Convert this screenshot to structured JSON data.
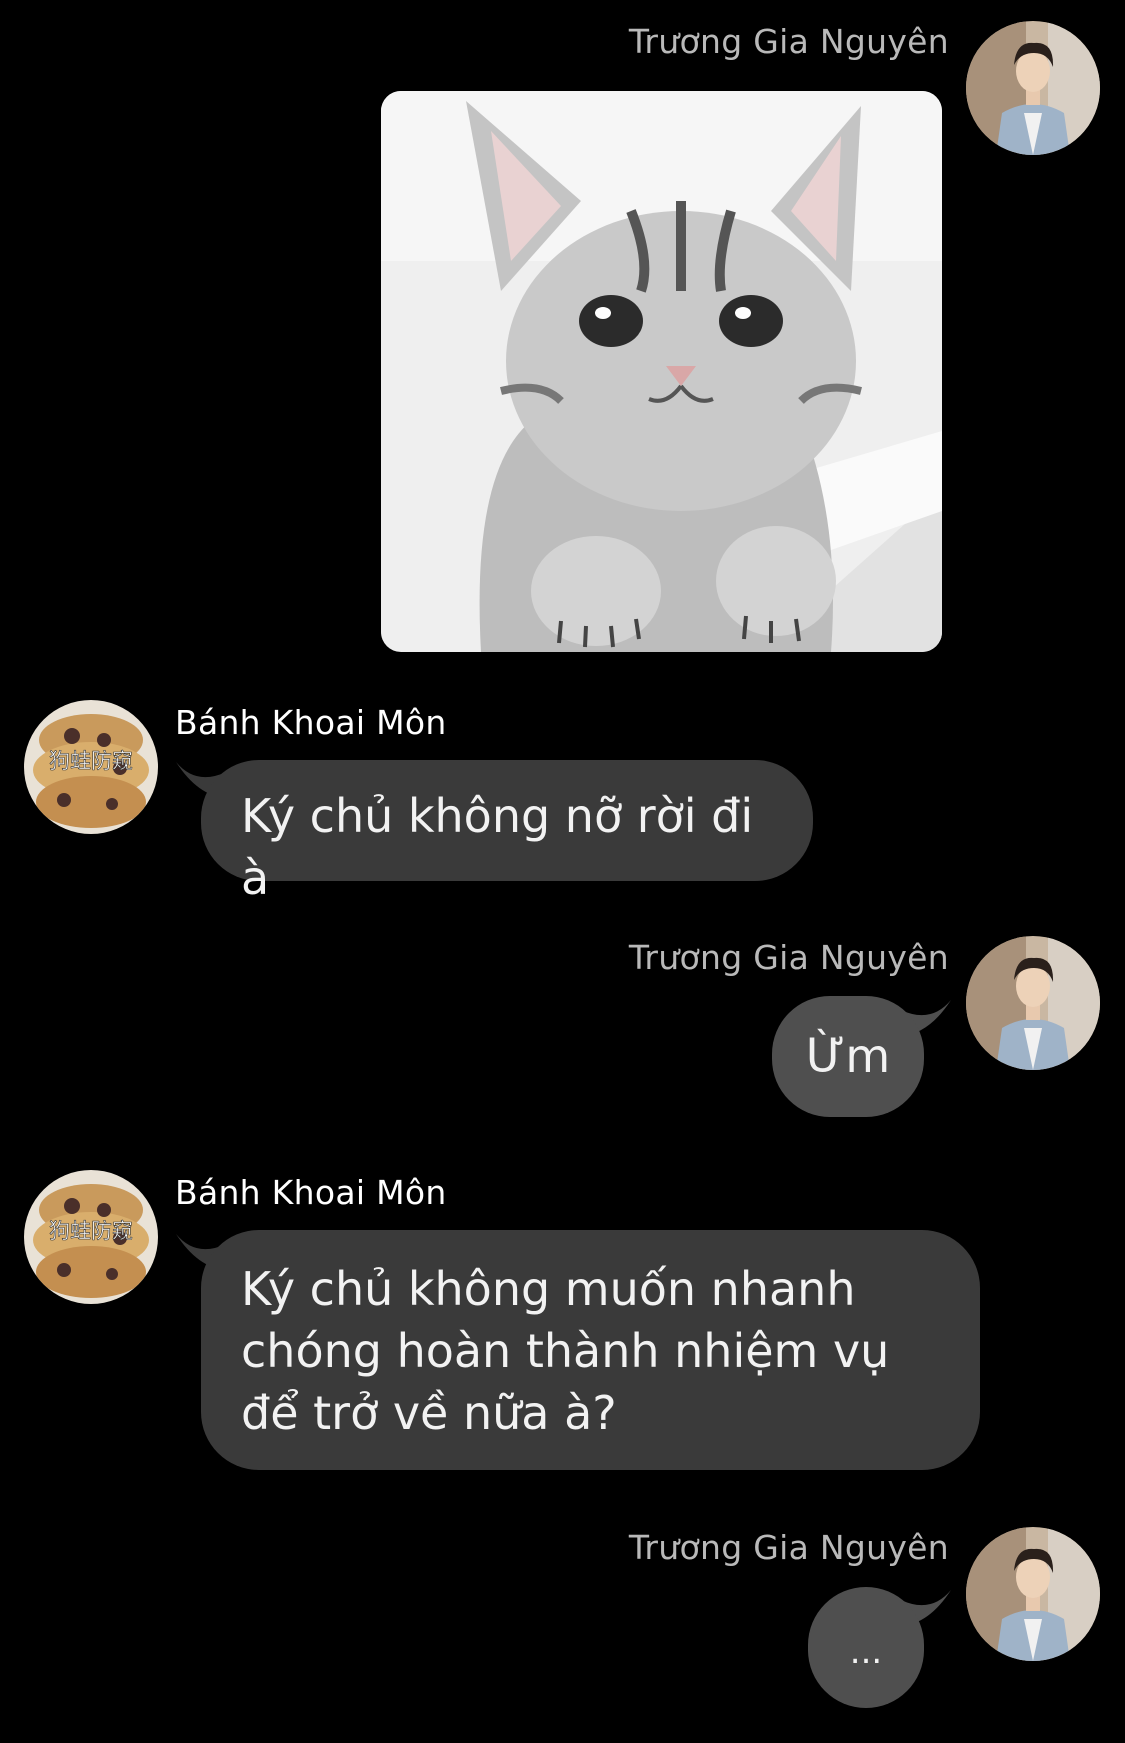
{
  "conversation": {
    "messages": [
      {
        "sender": "Trương Gia Nguyên",
        "type": "image",
        "image_description": "sad-cat-sticker"
      },
      {
        "sender": "Bánh Khoai Môn",
        "type": "text",
        "text": "Ký chủ không nỡ rời đi à"
      },
      {
        "sender": "Trương Gia Nguyên",
        "type": "text",
        "text": "Ừm"
      },
      {
        "sender": "Bánh Khoai Môn",
        "type": "text",
        "text": "Ký chủ không muốn nhanh chóng hoàn thành nhiệm vụ để trở về nữa à?"
      },
      {
        "sender": "Trương Gia Nguyên",
        "type": "text",
        "text": "..."
      }
    ]
  },
  "avatars": {
    "self": {
      "icon": "person-portrait-avatar-icon",
      "watermark": ""
    },
    "other": {
      "icon": "pastry-avatar-icon",
      "watermark": "狗蛙防窥"
    }
  },
  "colors": {
    "background": "#000000",
    "incoming_bubble": "#3a3a3a",
    "outgoing_bubble": "#4f4f4f",
    "self_name": "#b9b9b9",
    "other_name": "#ffffff"
  }
}
